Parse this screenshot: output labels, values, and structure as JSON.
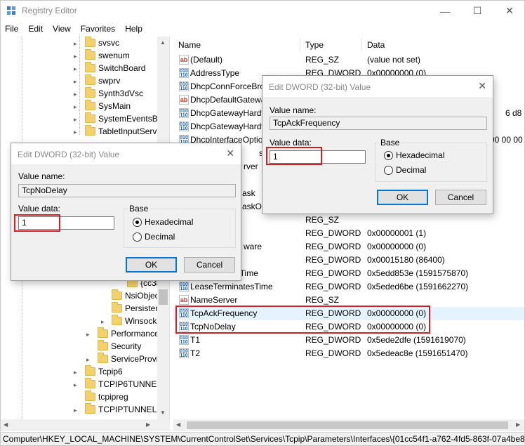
{
  "window": {
    "title": "Registry Editor"
  },
  "menu": [
    "File",
    "Edit",
    "View",
    "Favorites",
    "Help"
  ],
  "tree": [
    "svsvc",
    "swenum",
    "SwitchBoard",
    "swprv",
    "Synth3dVsc",
    "SysMain",
    "SystemEventsBr",
    "TabletInputServi",
    "{cc38",
    "NsiObjec",
    "Persisten",
    "Winsock",
    "Performance",
    "Security",
    "ServiceProvi",
    "Tcpip6",
    "TCPIP6TUNNEL",
    "tcpipreg",
    "TCPIPTUNNEL"
  ],
  "list": {
    "headers": {
      "name": "Name",
      "type": "Type",
      "data": "Data"
    },
    "rows": [
      {
        "icon": "string-value-icon",
        "name": "(Default)",
        "type": "REG_SZ",
        "data": "(value not set)"
      },
      {
        "icon": "binary-value-icon",
        "name": "AddressType",
        "type": "REG_DWORD",
        "data": "0x00000000 (0)"
      },
      {
        "icon": "binary-value-icon",
        "name": "DhcpConnForceBro",
        "type": "",
        "data": ""
      },
      {
        "icon": "string-value-icon",
        "name": "DhcpDefaultGatewa",
        "type": "",
        "data": ""
      },
      {
        "icon": "binary-value-icon",
        "name": "DhcpGatewayHardv",
        "type": "",
        "data": "6 d8"
      },
      {
        "icon": "binary-value-icon",
        "name": "DhcpGatewayHardv",
        "type": "",
        "data": ""
      },
      {
        "icon": "binary-value-icon",
        "name": "DhcpInterfaceOptio",
        "type": "",
        "data": "00 00 00"
      },
      {
        "icon": "binary-value-icon",
        "name": "s",
        "type": "",
        "data": ""
      },
      {
        "icon": "string-value-icon",
        "name": "rver",
        "type": "",
        "data": ""
      },
      {
        "icon": "binary-value-icon",
        "name": "",
        "type": "",
        "data": ""
      },
      {
        "icon": "binary-value-icon",
        "name": "ask",
        "type": "",
        "data": ""
      },
      {
        "icon": "binary-value-icon",
        "name": "askO",
        "type": "",
        "data": ""
      },
      {
        "icon": "string-value-icon",
        "name": "",
        "type": "REG_SZ",
        "data": ""
      },
      {
        "icon": "binary-value-icon",
        "name": "",
        "type": "REG_DWORD",
        "data": "0x00000001 (1)"
      },
      {
        "icon": "binary-value-icon",
        "name": "ware",
        "type": "REG_DWORD",
        "data": "0x00000000 (0)"
      },
      {
        "icon": "binary-value-icon",
        "name": "",
        "type": "REG_DWORD",
        "data": "0x00015180 (86400)"
      },
      {
        "icon": "binary-value-icon",
        "name": "dTime",
        "type": "REG_DWORD",
        "data": "0x5edd853e (1591575870)"
      },
      {
        "icon": "binary-value-icon",
        "name": "LeaseTerminatesTime",
        "type": "REG_DWORD",
        "data": "0x5eded6be (1591662270)"
      },
      {
        "icon": "string-value-icon",
        "name": "NameServer",
        "type": "REG_SZ",
        "data": ""
      },
      {
        "icon": "binary-value-icon",
        "name": "TcpAckFrequency",
        "type": "REG_DWORD",
        "data": "0x00000000 (0)"
      },
      {
        "icon": "binary-value-icon",
        "name": "TcpNoDelay",
        "type": "REG_DWORD",
        "data": "0x00000000 (0)"
      },
      {
        "icon": "binary-value-icon",
        "name": "T1",
        "type": "REG_DWORD",
        "data": "0x5ede2dfe (1591619070)"
      },
      {
        "icon": "binary-value-icon",
        "name": "T2",
        "type": "REG_DWORD",
        "data": "0x5edeac8e (1591651470)"
      }
    ]
  },
  "status": "Computer\\HKEY_LOCAL_MACHINE\\SYSTEM\\CurrentControlSet\\Services\\Tcpip\\Parameters\\Interfaces\\{01cc54f1-a762-4fd5-863f-07a4be8",
  "dialog_left": {
    "title": "Edit DWORD (32-bit) Value",
    "value_name_label": "Value name:",
    "value_name": "TcpNoDelay",
    "value_data_label": "Value data:",
    "value_data": "1",
    "base_label": "Base",
    "hex_label": "Hexadecimal",
    "dec_label": "Decimal",
    "base_selected": "Hexadecimal",
    "ok": "OK",
    "cancel": "Cancel"
  },
  "dialog_right": {
    "title": "Edit DWORD (32-bit) Value",
    "value_name_label": "Value name:",
    "value_name": "TcpAckFrequency",
    "value_data_label": "Value data:",
    "value_data": "1",
    "base_label": "Base",
    "hex_label": "Hexadecimal",
    "dec_label": "Decimal",
    "base_selected": "Hexadecimal",
    "ok": "OK",
    "cancel": "Cancel"
  },
  "colors": {
    "highlight_box": "#d41f26",
    "selected_row": "#e5f3ff",
    "dialog_bg": "#f0f0f0"
  }
}
